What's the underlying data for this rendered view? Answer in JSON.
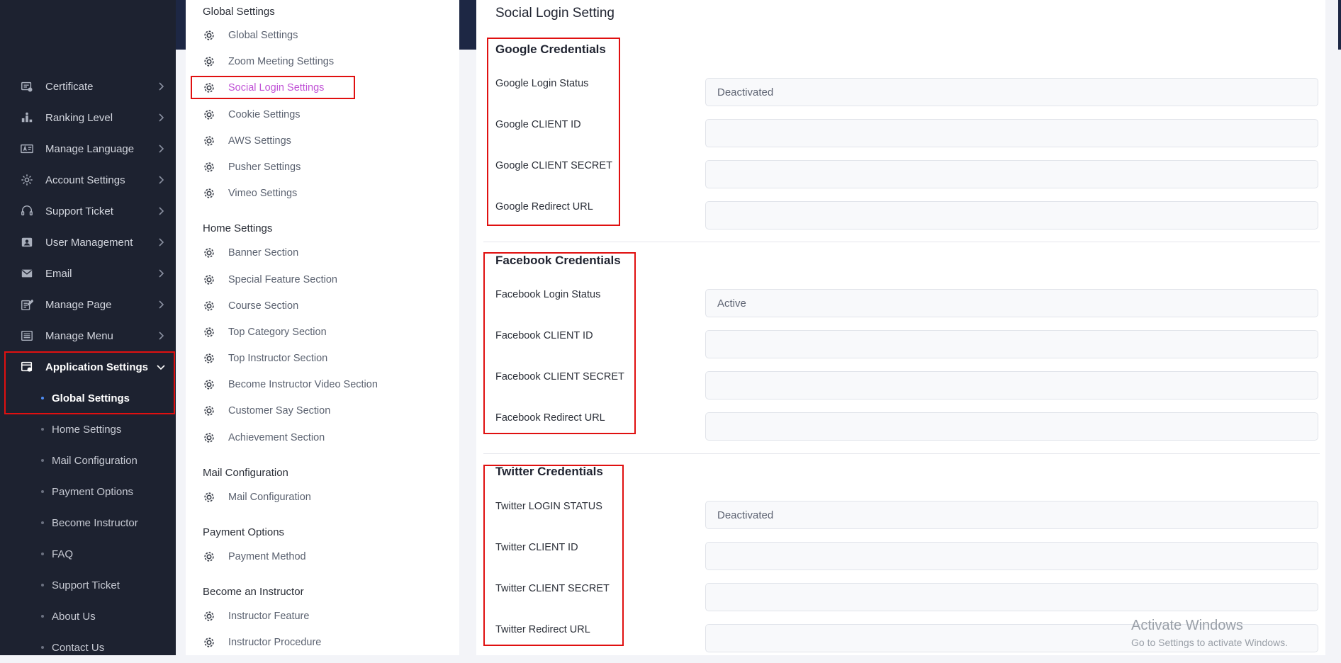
{
  "sidebar": {
    "items": [
      {
        "label": "Certificate",
        "icon": "certificate-icon"
      },
      {
        "label": "Ranking Level",
        "icon": "ranking-icon"
      },
      {
        "label": "Manage Language",
        "icon": "language-icon"
      },
      {
        "label": "Account Settings",
        "icon": "gear-icon"
      },
      {
        "label": "Support Ticket",
        "icon": "headset-icon"
      },
      {
        "label": "User Management",
        "icon": "user-icon"
      },
      {
        "label": "Email",
        "icon": "mail-icon"
      },
      {
        "label": "Manage Page",
        "icon": "page-edit-icon"
      },
      {
        "label": "Manage Menu",
        "icon": "menu-icon"
      },
      {
        "label": "Application Settings",
        "icon": "app-settings-icon"
      }
    ],
    "submenu": [
      {
        "label": "Global Settings"
      },
      {
        "label": "Home Settings"
      },
      {
        "label": "Mail Configuration"
      },
      {
        "label": "Payment Options"
      },
      {
        "label": "Become Instructor"
      },
      {
        "label": "FAQ"
      },
      {
        "label": "Support Ticket"
      },
      {
        "label": "About Us"
      },
      {
        "label": "Contact Us"
      }
    ]
  },
  "settings_list": {
    "groups": [
      {
        "title": "Global Settings",
        "items": [
          "Global Settings",
          "Zoom Meeting Settings",
          "Social Login Settings",
          "Cookie Settings",
          "AWS Settings",
          "Pusher Settings",
          "Vimeo Settings"
        ]
      },
      {
        "title": "Home Settings",
        "items": [
          "Banner Section",
          "Special Feature Section",
          "Course Section",
          "Top Category Section",
          "Top Instructor Section",
          "Become Instructor Video Section",
          "Customer Say Section",
          "Achievement Section"
        ]
      },
      {
        "title": "Mail Configuration",
        "items": [
          "Mail Configuration"
        ]
      },
      {
        "title": "Payment Options",
        "items": [
          "Payment Method"
        ]
      },
      {
        "title": "Become an Instructor",
        "items": [
          "Instructor Feature",
          "Instructor Procedure"
        ]
      }
    ]
  },
  "content": {
    "title": "Social Login Setting",
    "sections": [
      {
        "title": "Google Credentials",
        "fields": [
          {
            "label": "Google Login Status",
            "value": "Deactivated"
          },
          {
            "label": "Google CLIENT ID",
            "value": ""
          },
          {
            "label": "Google CLIENT SECRET",
            "value": ""
          },
          {
            "label": "Google Redirect URL",
            "value": ""
          }
        ]
      },
      {
        "title": "Facebook Credentials",
        "fields": [
          {
            "label": "Facebook Login Status",
            "value": "Active"
          },
          {
            "label": "Facebook CLIENT ID",
            "value": ""
          },
          {
            "label": "Facebook CLIENT SECRET",
            "value": ""
          },
          {
            "label": "Facebook Redirect URL",
            "value": ""
          }
        ]
      },
      {
        "title": "Twitter Credentials",
        "fields": [
          {
            "label": "Twitter LOGIN STATUS",
            "value": "Deactivated"
          },
          {
            "label": "Twitter CLIENT ID",
            "value": ""
          },
          {
            "label": "Twitter CLIENT SECRET",
            "value": ""
          },
          {
            "label": "Twitter Redirect URL",
            "value": ""
          }
        ]
      }
    ]
  },
  "watermark": {
    "line1": "Activate Windows",
    "line2": "Go to Settings to activate Windows."
  },
  "colors": {
    "sidebar_bg": "#1d2230",
    "active_link": "#c052d6",
    "highlight_box": "#e01010",
    "active_dot": "#4e8df5"
  }
}
